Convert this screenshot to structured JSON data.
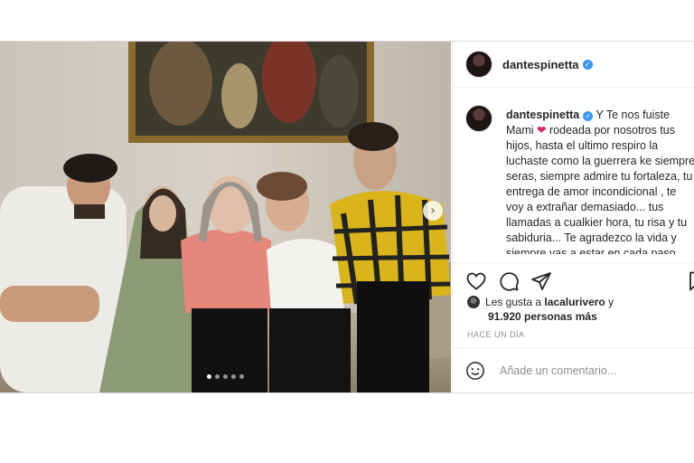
{
  "post": {
    "username": "dantespinetta",
    "verified": true,
    "carousel": {
      "total": 5,
      "current": 1
    },
    "caption": {
      "lead": "Y Te nos fuiste Mami",
      "emoji": "❤",
      "body": "rodeada por nosotros tus hijos, hasta el ultimo respiro la luchaste como la guerrera ke siempre seras, siempre admire tu fortaleza, tu entrega de amor incondicional , te voy a extrañar demasiado... tus llamadas a cualkier hora, tu risa y tu sabiduria... Te agradezco la vida y siempre vas a estar en cada paso que"
    },
    "likes": {
      "prefix": "Les gusta a",
      "user": "lacalurivero",
      "connector": "y",
      "count_text": "91.920 personas más"
    },
    "time_ago": "HACE UN DÍA",
    "comment_placeholder": "Añade un comentario...",
    "icons": {
      "like": "heart-outline-icon",
      "comment": "comment-bubble-icon",
      "share": "paper-plane-icon",
      "save": "bookmark-icon",
      "emoji": "smiley-icon",
      "next": "chevron-right-icon"
    },
    "colors": {
      "verified": "#3897f0",
      "heart": "#e0245e",
      "muted": "#8e8e8e"
    }
  }
}
